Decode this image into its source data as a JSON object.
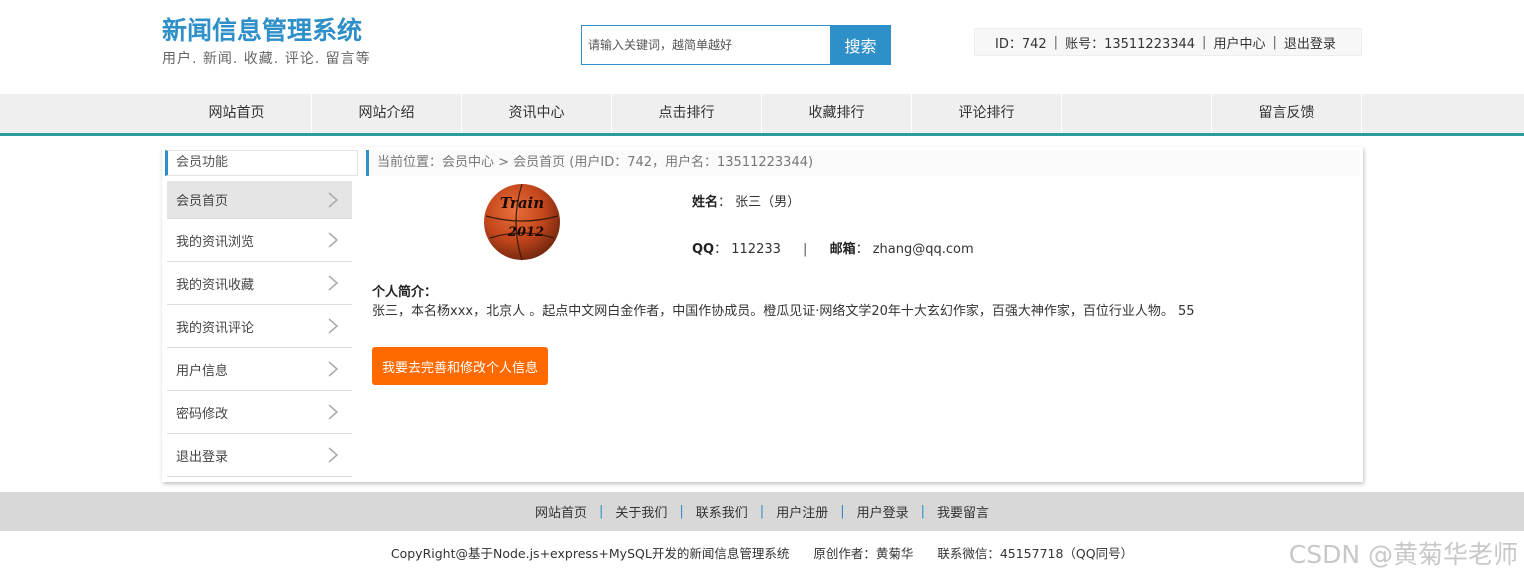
{
  "header": {
    "title": "新闻信息管理系统",
    "subtitle": "用户. 新闻. 收藏. 评论. 留言等",
    "search_placeholder": "请输入关键词，越简单越好",
    "search_button": "搜索",
    "user_id_text": "ID：742",
    "account_text": "账号：13511223344",
    "user_center": "用户中心",
    "logout": "退出登录"
  },
  "nav": {
    "items": [
      "网站首页",
      "网站介绍",
      "资讯中心",
      "点击排行",
      "收藏排行",
      "评论排行"
    ],
    "last": "留言反馈"
  },
  "sidebar": {
    "title": "会员功能",
    "items": [
      "会员首页",
      "我的资讯浏览",
      "我的资讯收藏",
      "我的资讯评论",
      "用户信息",
      "密码修改",
      "退出登录"
    ]
  },
  "content": {
    "breadcrumb": "当前位置：会员中心 > 会员首页 (用户ID：742，用户名：13511223344)",
    "name_label": "姓名",
    "name_value": "张三（男）",
    "qq_label": "QQ",
    "qq_value": "112233",
    "email_label": "邮箱",
    "email_value": "zhang@qq.com",
    "bio_label": "个人简介：",
    "bio_text": "张三，本名杨xxx，北京人 。起点中文网白金作者，中国作协成员。橙瓜见证·网络文学20年十大玄幻作家，百强大神作家，百位行业人物。 55",
    "edit_button": "我要去完善和修改个人信息",
    "ball_text": "Train",
    "ball_sub": "2012"
  },
  "footer": {
    "links": [
      "网站首页",
      "关于我们",
      "联系我们",
      "用户注册",
      "用户登录",
      "我要留言"
    ],
    "copyright": "CopyRight@基于Node.js+express+MySQL开发的新闻信息管理系统",
    "author": "原创作者：黄菊华",
    "contact": "联系微信：45157718（QQ同号）",
    "watermark": "CSDN @黄菊华老师"
  },
  "colors": {
    "accent": "#2f8fc9",
    "nav_border": "#2a9c9c",
    "button": "#ff6a00"
  }
}
